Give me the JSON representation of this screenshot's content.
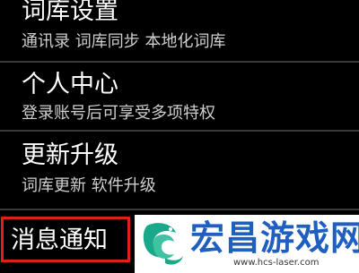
{
  "menu": {
    "items": [
      {
        "title": "词库设置",
        "subtitle": "通讯录 词库同步 本地化词库"
      },
      {
        "title": "个人中心",
        "subtitle": "登录账号后可享受多项特权"
      },
      {
        "title": "更新升级",
        "subtitle": "词库更新 软件升级"
      },
      {
        "title": "消息通知"
      }
    ]
  },
  "watermark": {
    "brand": "宏昌游戏网",
    "url": "www.hcs-laser.com",
    "brand_color": "#1f5fbf",
    "logo_color": "#1aa88a"
  },
  "colors": {
    "background": "#000000",
    "text": "#ffffff",
    "subtext": "#cfcfcf",
    "highlight": "#e01e1e"
  }
}
